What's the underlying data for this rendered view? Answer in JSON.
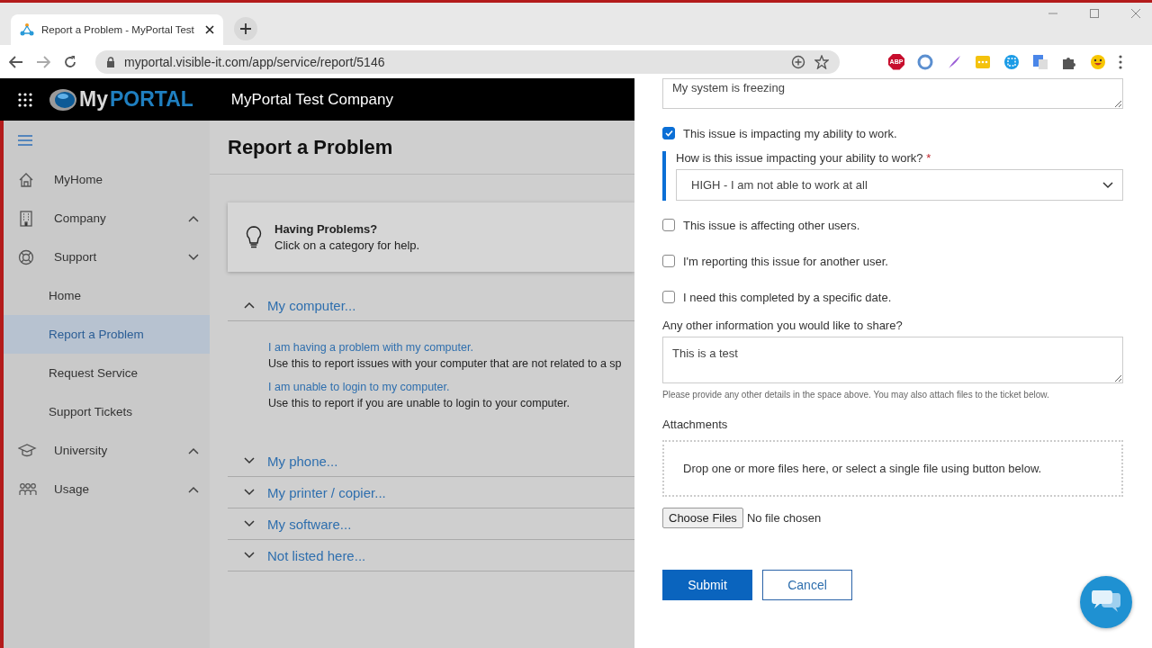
{
  "browser": {
    "tab_title": "Report a Problem - MyPortal Test",
    "url": "myportal.visible-it.com/app/service/report/5146",
    "adblock_label": "ABP"
  },
  "header": {
    "logo_parts": [
      "My",
      "PORTAL"
    ],
    "company": "MyPortal Test Company"
  },
  "sidebar": {
    "items": [
      {
        "label": "MyHome"
      },
      {
        "label": "Company",
        "expanded": false
      },
      {
        "label": "Support",
        "expanded": true,
        "children": [
          {
            "label": "Home",
            "selected": false
          },
          {
            "label": "Report a Problem",
            "selected": true
          },
          {
            "label": "Request Service",
            "selected": false
          },
          {
            "label": "Support Tickets",
            "selected": false
          }
        ]
      },
      {
        "label": "University",
        "expanded": false
      },
      {
        "label": "Usage",
        "expanded": false
      }
    ]
  },
  "main": {
    "title": "Report a Problem",
    "help_card": {
      "title": "Having Problems?",
      "text": "Click on a category for help."
    },
    "categories": [
      {
        "label": "My computer...",
        "expanded": true,
        "options": [
          {
            "link": "I am having a problem with my computer.",
            "description": "Use this to report issues with your computer that are not related to a sp"
          },
          {
            "link": "I am unable to login to my computer.",
            "description": "Use this to report if you are unable to login to your computer."
          }
        ]
      },
      {
        "label": "My phone...",
        "expanded": false
      },
      {
        "label": "My printer / copier...",
        "expanded": false
      },
      {
        "label": "My software...",
        "expanded": false
      },
      {
        "label": "Not listed here...",
        "expanded": false
      }
    ]
  },
  "panel": {
    "fields": [
      {
        "kind": "textarea",
        "value": "My system is freezing"
      },
      {
        "kind": "checkbox",
        "label": "This issue is impacting my ability to work.",
        "checked": true
      },
      {
        "kind": "select",
        "label": "How is this issue impacting your ability to work?",
        "required_mark": "*",
        "value": "HIGH - I am not able to work at all"
      },
      {
        "kind": "checkbox",
        "label": "This issue is affecting other users.",
        "checked": false
      },
      {
        "kind": "checkbox",
        "label": "I'm reporting this issue for another user.",
        "checked": false
      },
      {
        "kind": "checkbox",
        "label": "I need this completed by a specific date.",
        "checked": false
      },
      {
        "kind": "textarea",
        "label": "Any other information you would like to share?",
        "value": "This is a test",
        "hint": "Please provide any other details in the space above. You may also attach files to the ticket below."
      }
    ],
    "attachments": {
      "label": "Attachments",
      "dropzone": "Drop one or more files here, or select a single file using button below.",
      "choose_button": "Choose Files",
      "file_status": "No file chosen"
    },
    "buttons": [
      {
        "label": "Submit",
        "kind": "primary"
      },
      {
        "label": "Cancel",
        "kind": "secondary"
      }
    ]
  }
}
